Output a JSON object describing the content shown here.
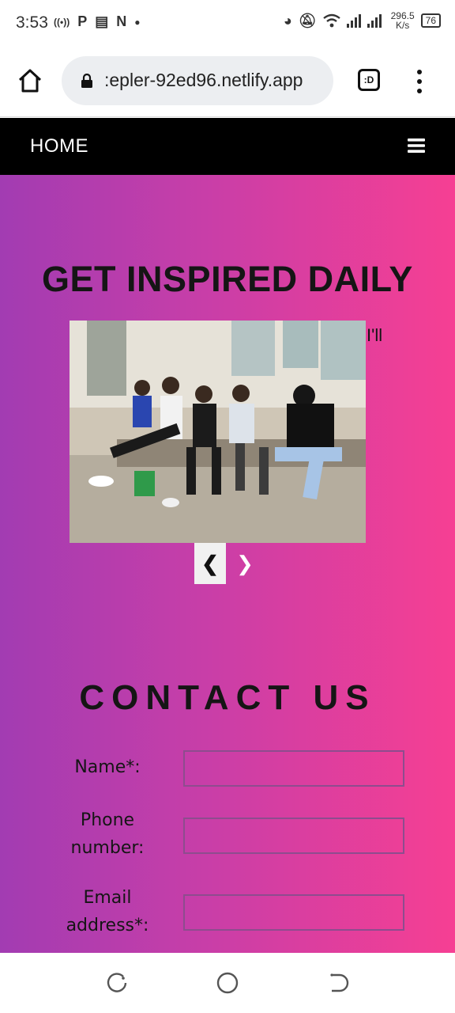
{
  "status_bar": {
    "time": "3:53",
    "left_icons": [
      "radio-icon",
      "p-app-icon",
      "message-icon",
      "n-app-icon",
      "dot-icon"
    ],
    "net_speed_value": "296.5",
    "net_speed_unit": "K/s",
    "battery": "76"
  },
  "browser": {
    "url": ":epler-92ed96.netlify.app",
    "tabs_label": ":D"
  },
  "site_nav": {
    "home_label": "HOME"
  },
  "hero": {
    "title": "GET INSPIRED DAILY",
    "stray_text": "I'll",
    "prev_label": "❮",
    "next_label": "❯"
  },
  "contact": {
    "title": "CONTACT US",
    "fields": [
      {
        "label": "Name*:",
        "value": ""
      },
      {
        "label": "Phone number:",
        "value": ""
      },
      {
        "label": "Email address*:",
        "value": ""
      }
    ]
  },
  "colors": {
    "gradient_start": "#a23cb2",
    "gradient_end": "#f63f93",
    "nav_bg": "#000000"
  }
}
